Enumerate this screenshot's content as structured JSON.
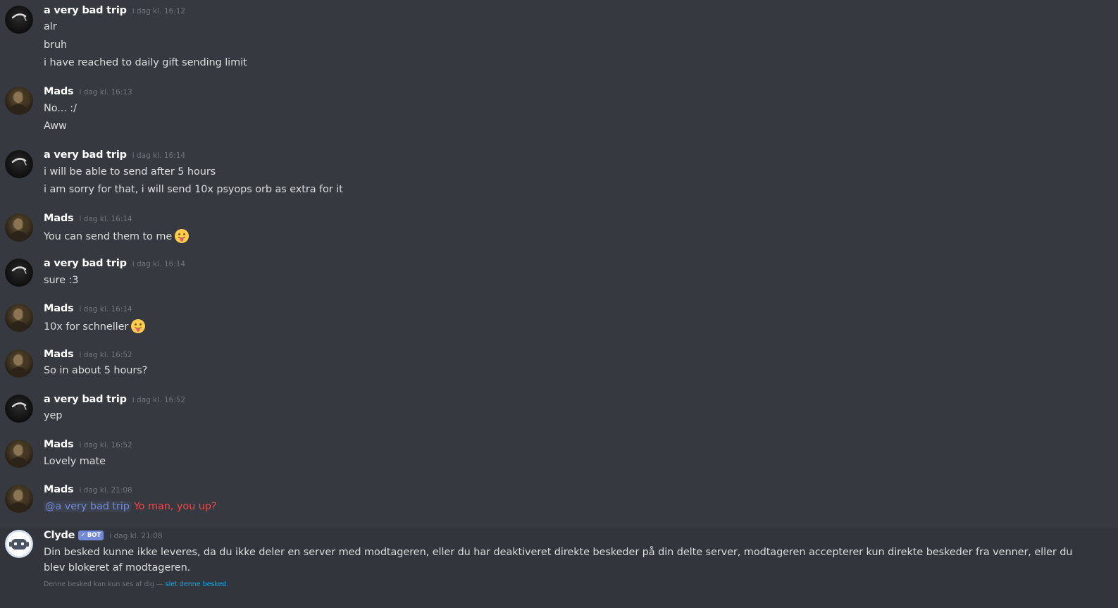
{
  "users": {
    "trip": "a very bad trip",
    "mads": "Mads",
    "clyde": "Clyde"
  },
  "groups": [
    {
      "author": "a very bad trip",
      "time": "i dag kl. 16:12",
      "lines": [
        "alr",
        "bruh",
        "i have reached to daily gift sending limit"
      ]
    },
    {
      "author": "Mads",
      "time": "i dag kl. 16:13",
      "lines": [
        "No... :/",
        "Aww"
      ]
    },
    {
      "author": "a very bad trip",
      "time": "i dag kl. 16:14",
      "lines": [
        "i will be able to send after 5 hours",
        "i am sorry for that, i will send 10x psyops orb as extra for it"
      ]
    },
    {
      "author": "Mads",
      "time": "i dag kl. 16:14",
      "lines": [
        "You can send them to me"
      ]
    },
    {
      "author": "a very bad trip",
      "time": "i dag kl. 16:14",
      "lines": [
        "sure :3"
      ]
    },
    {
      "author": "Mads",
      "time": "i dag kl. 16:14",
      "lines": [
        "10x for schneller"
      ]
    },
    {
      "author": "Mads",
      "time": "i dag kl. 16:52",
      "lines": [
        "So in about 5 hours?"
      ]
    },
    {
      "author": "a very bad trip",
      "time": "i dag kl. 16:52",
      "lines": [
        "yep"
      ]
    },
    {
      "author": "Mads",
      "time": "i dag kl. 16:52",
      "lines": [
        "Lovely mate"
      ]
    },
    {
      "author": "Mads",
      "time": "i dag kl. 21:08",
      "mention": "@a very bad trip",
      "red_text": "Yo man, you up?"
    }
  ],
  "clyde_message": {
    "author": "Clyde",
    "badge": "BOT",
    "badge_icon": "check-icon",
    "time": "i dag kl. 21:08",
    "text": "Din besked kunne ikke leveres, da du ikke deler en server med modtageren, eller du har deaktiveret direkte beskeder på din delte server, modtageren accepterer kun direkte beskeder fra venner, eller du blev blokeret af modtageren.",
    "ephemeral_note": "Denne besked kan kun ses af dig —",
    "delete_link": "slet denne besked."
  },
  "emoji": "tongue-out-emoji",
  "colors": {
    "background": "#36393f",
    "mention": "#7289da",
    "red_text": "#f04747",
    "link": "#00b0f4",
    "bot_badge": "#7289da"
  }
}
